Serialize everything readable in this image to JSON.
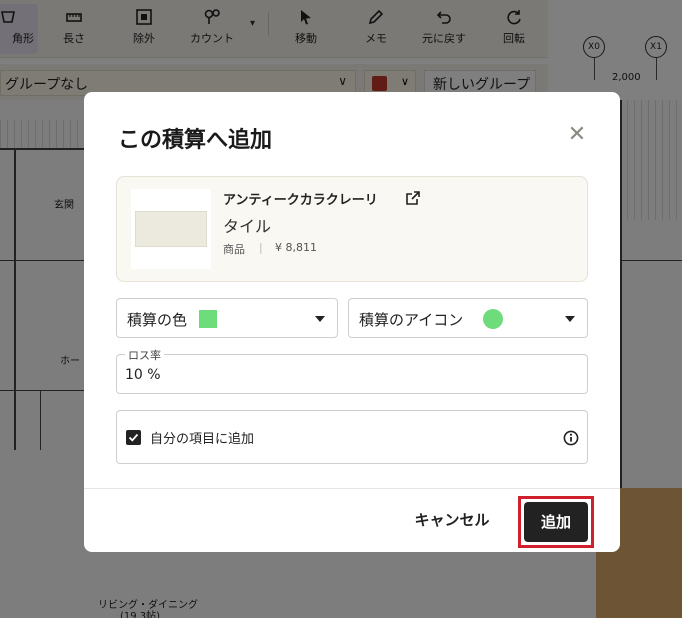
{
  "toolbar": {
    "items": [
      {
        "label": "角形",
        "icon": "polygon-icon"
      },
      {
        "label": "長さ",
        "icon": "ruler-icon"
      },
      {
        "label": "除外",
        "icon": "exclude-icon"
      },
      {
        "label": "カウント",
        "icon": "count-icon"
      },
      {
        "label": "移動",
        "icon": "cursor-icon"
      },
      {
        "label": "メモ",
        "icon": "pen-icon"
      },
      {
        "label": "元に戻す",
        "icon": "undo-icon"
      },
      {
        "label": "回転",
        "icon": "rotate-icon"
      }
    ]
  },
  "group_bar": {
    "group_select": "グループなし",
    "group_color": "#c0392b",
    "new_group_button": "新しいグループ"
  },
  "drawing": {
    "grid_bubbles": [
      "X0",
      "X1"
    ],
    "dimension": "2,000",
    "labels": [
      "玄関",
      "ホー",
      "リビング・ダイニング",
      "(19.3帖)"
    ]
  },
  "modal": {
    "title": "この積算へ追加",
    "product": {
      "name": "アンティークカラクレーリ",
      "category": "タイル",
      "type": "商品",
      "separator": "|",
      "price": "¥ 8,811"
    },
    "color_dropdown": {
      "label": "積算の色",
      "value_color": "#6fdc7b"
    },
    "icon_dropdown": {
      "label": "積算のアイコン",
      "value_color": "#6fdc7b"
    },
    "loss_rate": {
      "label": "ロス率",
      "value": "10 %"
    },
    "add_to_my_items": {
      "label": "自分の項目に追加",
      "checked": true
    },
    "cancel_button": "キャンセル",
    "add_button": "追加"
  }
}
